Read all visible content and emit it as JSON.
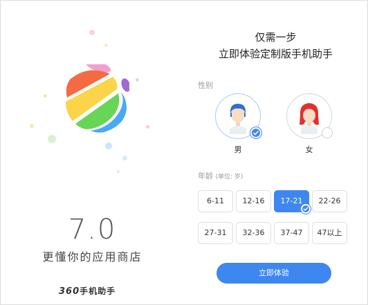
{
  "colors": {
    "accent": "#3e87f0",
    "logo_orange": "#f46b43",
    "logo_yellow": "#fbd44a",
    "logo_green": "#67d556",
    "logo_blue": "#4ba8f3",
    "logo_pink": "#f29fd0",
    "logo_purple": "#a06bd6"
  },
  "left": {
    "version": "7.0",
    "tagline": "更懂你的应用商店",
    "brand_num": "360",
    "brand_text": "手机助手"
  },
  "right": {
    "title_line1": "仅需一步",
    "title_line2": "立即体验定制版手机助手",
    "gender_label": "性别",
    "male_label": "男",
    "female_label": "女",
    "age_label": "年龄",
    "age_unit": "(单位: 岁)",
    "ages": [
      "6-11",
      "12-16",
      "17-21",
      "22-26",
      "27-31",
      "32-36",
      "37-47",
      "47以上"
    ],
    "selected_age": "17-21",
    "selected_gender": "男",
    "button_label": "立即体验"
  }
}
